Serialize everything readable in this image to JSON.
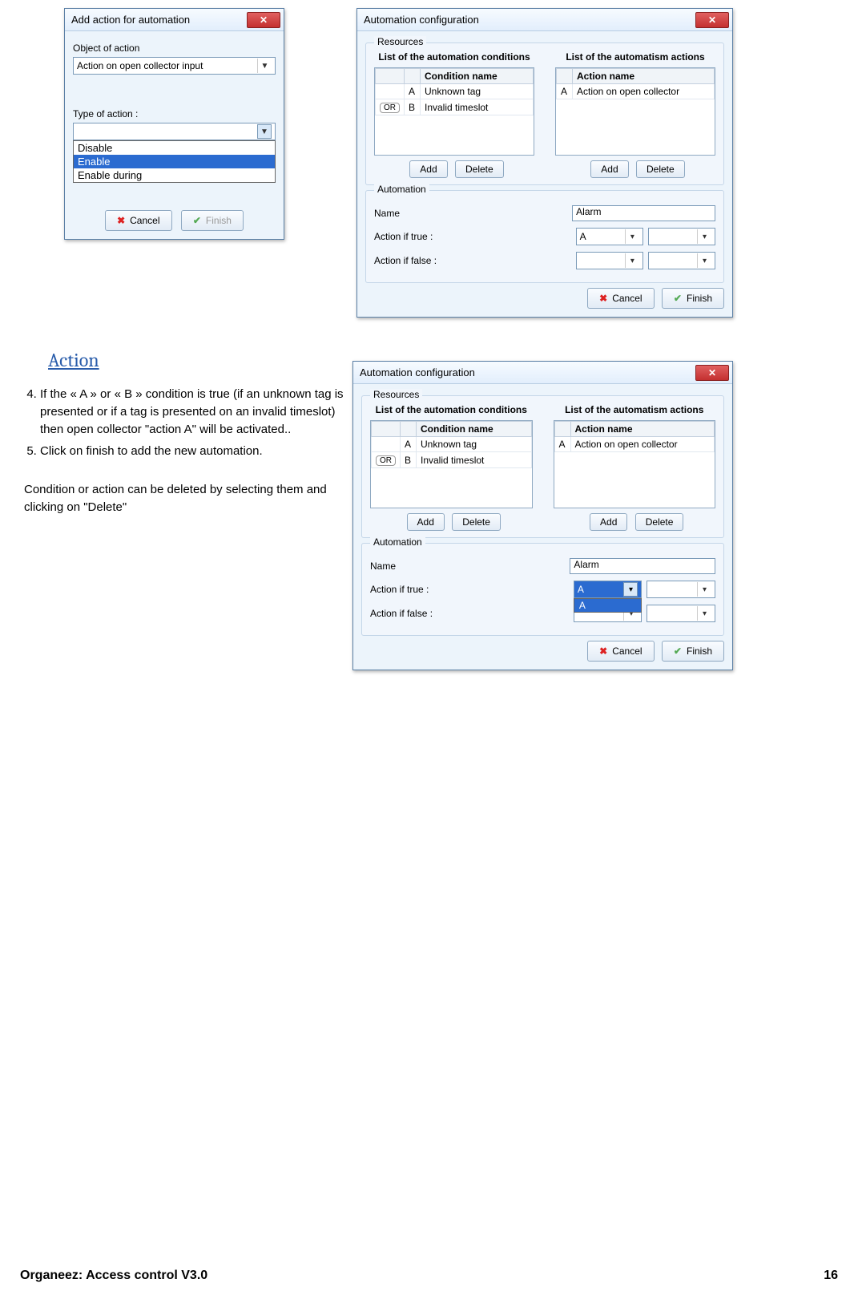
{
  "win1": {
    "title": "Add action for automation",
    "object_label": "Object of action",
    "object_value": "Action on open collector input",
    "type_label": "Type of action :",
    "type_value": "",
    "type_options": [
      "Disable",
      "Enable",
      "Enable during"
    ],
    "type_selected": "Enable",
    "cancel": "Cancel",
    "finish": "Finish"
  },
  "win2": {
    "title": "Automation configuration",
    "resources": "Resources",
    "conditions_hdr": "List of the automation conditions",
    "actions_hdr": "List of the automatism actions",
    "cond_col": "Condition name",
    "act_col": "Action name",
    "conds": [
      {
        "op": "",
        "id": "A",
        "name": "Unknown tag"
      },
      {
        "op": "OR",
        "id": "B",
        "name": "Invalid timeslot"
      }
    ],
    "acts": [
      {
        "id": "A",
        "name": "Action on open collector"
      }
    ],
    "add": "Add",
    "delete": "Delete",
    "automation": "Automation",
    "name_lbl": "Name",
    "name_val": "Alarm",
    "true_lbl": "Action if true :",
    "true_val": "A",
    "false_lbl": "Action if false :",
    "false_val": "",
    "cancel": "Cancel",
    "finish": "Finish"
  },
  "win3": {
    "title": "Automation configuration",
    "dropdown_open": "A",
    "dropdown_options": [
      "A"
    ]
  },
  "text": {
    "heading": "Action",
    "step4": "If the « A » or « B » condition is true (if an unknown tag is presented or if a tag is presented on an invalid timeslot) then open collector \"action A\" will be activated..",
    "step5": "Click on finish to add the new automation.",
    "para": "Condition or action can be deleted by selecting them and clicking on \"Delete\""
  },
  "footer": {
    "left": "Organeez: Access control    V3.0",
    "right": "16"
  }
}
